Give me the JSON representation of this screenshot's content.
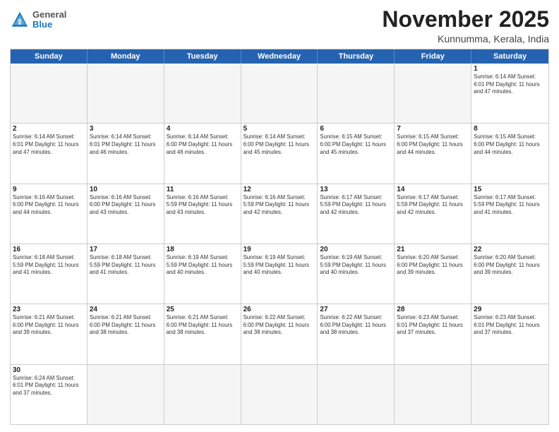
{
  "header": {
    "logo": {
      "general": "General",
      "blue": "Blue"
    },
    "title": "November 2025",
    "location": "Kunnumma, Kerala, India"
  },
  "days": [
    "Sunday",
    "Monday",
    "Tuesday",
    "Wednesday",
    "Thursday",
    "Friday",
    "Saturday"
  ],
  "weeks": [
    [
      {
        "day": "",
        "info": ""
      },
      {
        "day": "",
        "info": ""
      },
      {
        "day": "",
        "info": ""
      },
      {
        "day": "",
        "info": ""
      },
      {
        "day": "",
        "info": ""
      },
      {
        "day": "",
        "info": ""
      },
      {
        "day": "1",
        "info": "Sunrise: 6:14 AM\nSunset: 6:01 PM\nDaylight: 11 hours\nand 47 minutes."
      }
    ],
    [
      {
        "day": "2",
        "info": "Sunrise: 6:14 AM\nSunset: 6:01 PM\nDaylight: 11 hours\nand 47 minutes."
      },
      {
        "day": "3",
        "info": "Sunrise: 6:14 AM\nSunset: 6:01 PM\nDaylight: 11 hours\nand 46 minutes."
      },
      {
        "day": "4",
        "info": "Sunrise: 6:14 AM\nSunset: 6:00 PM\nDaylight: 11 hours\nand 46 minutes."
      },
      {
        "day": "5",
        "info": "Sunrise: 6:14 AM\nSunset: 6:00 PM\nDaylight: 11 hours\nand 45 minutes."
      },
      {
        "day": "6",
        "info": "Sunrise: 6:15 AM\nSunset: 6:00 PM\nDaylight: 11 hours\nand 45 minutes."
      },
      {
        "day": "7",
        "info": "Sunrise: 6:15 AM\nSunset: 6:00 PM\nDaylight: 11 hours\nand 44 minutes."
      },
      {
        "day": "8",
        "info": "Sunrise: 6:15 AM\nSunset: 6:00 PM\nDaylight: 11 hours\nand 44 minutes."
      }
    ],
    [
      {
        "day": "9",
        "info": "Sunrise: 6:16 AM\nSunset: 6:00 PM\nDaylight: 11 hours\nand 44 minutes."
      },
      {
        "day": "10",
        "info": "Sunrise: 6:16 AM\nSunset: 6:00 PM\nDaylight: 11 hours\nand 43 minutes."
      },
      {
        "day": "11",
        "info": "Sunrise: 6:16 AM\nSunset: 5:59 PM\nDaylight: 11 hours\nand 43 minutes."
      },
      {
        "day": "12",
        "info": "Sunrise: 6:16 AM\nSunset: 5:59 PM\nDaylight: 11 hours\nand 42 minutes."
      },
      {
        "day": "13",
        "info": "Sunrise: 6:17 AM\nSunset: 5:59 PM\nDaylight: 11 hours\nand 42 minutes."
      },
      {
        "day": "14",
        "info": "Sunrise: 6:17 AM\nSunset: 5:59 PM\nDaylight: 11 hours\nand 42 minutes."
      },
      {
        "day": "15",
        "info": "Sunrise: 6:17 AM\nSunset: 5:59 PM\nDaylight: 11 hours\nand 41 minutes."
      }
    ],
    [
      {
        "day": "16",
        "info": "Sunrise: 6:18 AM\nSunset: 5:59 PM\nDaylight: 11 hours\nand 41 minutes."
      },
      {
        "day": "17",
        "info": "Sunrise: 6:18 AM\nSunset: 5:59 PM\nDaylight: 11 hours\nand 41 minutes."
      },
      {
        "day": "18",
        "info": "Sunrise: 6:19 AM\nSunset: 5:59 PM\nDaylight: 11 hours\nand 40 minutes."
      },
      {
        "day": "19",
        "info": "Sunrise: 6:19 AM\nSunset: 5:59 PM\nDaylight: 11 hours\nand 40 minutes."
      },
      {
        "day": "20",
        "info": "Sunrise: 6:19 AM\nSunset: 5:59 PM\nDaylight: 11 hours\nand 40 minutes."
      },
      {
        "day": "21",
        "info": "Sunrise: 6:20 AM\nSunset: 6:00 PM\nDaylight: 11 hours\nand 39 minutes."
      },
      {
        "day": "22",
        "info": "Sunrise: 6:20 AM\nSunset: 6:00 PM\nDaylight: 11 hours\nand 39 minutes."
      }
    ],
    [
      {
        "day": "23",
        "info": "Sunrise: 6:21 AM\nSunset: 6:00 PM\nDaylight: 11 hours\nand 39 minutes."
      },
      {
        "day": "24",
        "info": "Sunrise: 6:21 AM\nSunset: 6:00 PM\nDaylight: 11 hours\nand 38 minutes."
      },
      {
        "day": "25",
        "info": "Sunrise: 6:21 AM\nSunset: 6:00 PM\nDaylight: 11 hours\nand 38 minutes."
      },
      {
        "day": "26",
        "info": "Sunrise: 6:22 AM\nSunset: 6:00 PM\nDaylight: 11 hours\nand 38 minutes."
      },
      {
        "day": "27",
        "info": "Sunrise: 6:22 AM\nSunset: 6:00 PM\nDaylight: 11 hours\nand 38 minutes."
      },
      {
        "day": "28",
        "info": "Sunrise: 6:23 AM\nSunset: 6:01 PM\nDaylight: 11 hours\nand 37 minutes."
      },
      {
        "day": "29",
        "info": "Sunrise: 6:23 AM\nSunset: 6:01 PM\nDaylight: 11 hours\nand 37 minutes."
      }
    ],
    [
      {
        "day": "30",
        "info": "Sunrise: 6:24 AM\nSunset: 6:01 PM\nDaylight: 11 hours\nand 37 minutes."
      },
      {
        "day": "",
        "info": ""
      },
      {
        "day": "",
        "info": ""
      },
      {
        "day": "",
        "info": ""
      },
      {
        "day": "",
        "info": ""
      },
      {
        "day": "",
        "info": ""
      },
      {
        "day": "",
        "info": ""
      }
    ]
  ]
}
